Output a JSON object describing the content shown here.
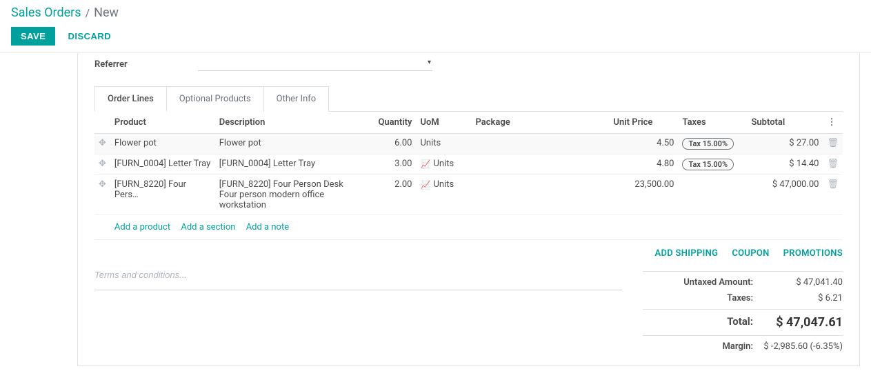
{
  "breadcrumb": {
    "root": "Sales Orders",
    "sep": "/",
    "current": "New"
  },
  "buttons": {
    "save": "SAVE",
    "discard": "DISCARD"
  },
  "form": {
    "referrer_label": "Referrer"
  },
  "tabs": {
    "order_lines": "Order Lines",
    "optional_products": "Optional Products",
    "other_info": "Other Info"
  },
  "columns": {
    "product": "Product",
    "description": "Description",
    "quantity": "Quantity",
    "uom": "UoM",
    "package": "Package",
    "unit_price": "Unit Price",
    "taxes": "Taxes",
    "subtotal": "Subtotal"
  },
  "rows": [
    {
      "product": "Flower pot",
      "description": "Flower pot",
      "qty": "6.00",
      "uom_icon": "",
      "uom": "Units",
      "unit_price": "4.50",
      "tax": "Tax 15.00%",
      "subtotal": "$ 27.00"
    },
    {
      "product": "[FURN_0004] Letter Tray",
      "description": "[FURN_0004] Letter Tray",
      "qty": "3.00",
      "uom_icon": "red",
      "uom": "Units",
      "unit_price": "4.80",
      "tax": "Tax 15.00%",
      "subtotal": "$ 14.40"
    },
    {
      "product": "[FURN_8220] Four Pers…",
      "description": "[FURN_8220] Four Person Desk\nFour person modern office workstation",
      "qty": "2.00",
      "uom_icon": "teal",
      "uom": "Units",
      "unit_price": "23,500.00",
      "tax": "",
      "subtotal": "$ 47,000.00"
    }
  ],
  "add_links": {
    "product": "Add a product",
    "section": "Add a section",
    "note": "Add a note"
  },
  "actions": {
    "shipping": "ADD SHIPPING",
    "coupon": "COUPON",
    "promotions": "PROMOTIONS"
  },
  "terms_placeholder": "Terms and conditions...",
  "totals": {
    "untaxed_label": "Untaxed Amount:",
    "untaxed_value": "$ 47,041.40",
    "taxes_label": "Taxes:",
    "taxes_value": "$ 6.21",
    "total_label": "Total:",
    "total_value": "$ 47,047.61",
    "margin_label": "Margin:",
    "margin_value": "$ -2,985.60 (-6.35%)"
  }
}
